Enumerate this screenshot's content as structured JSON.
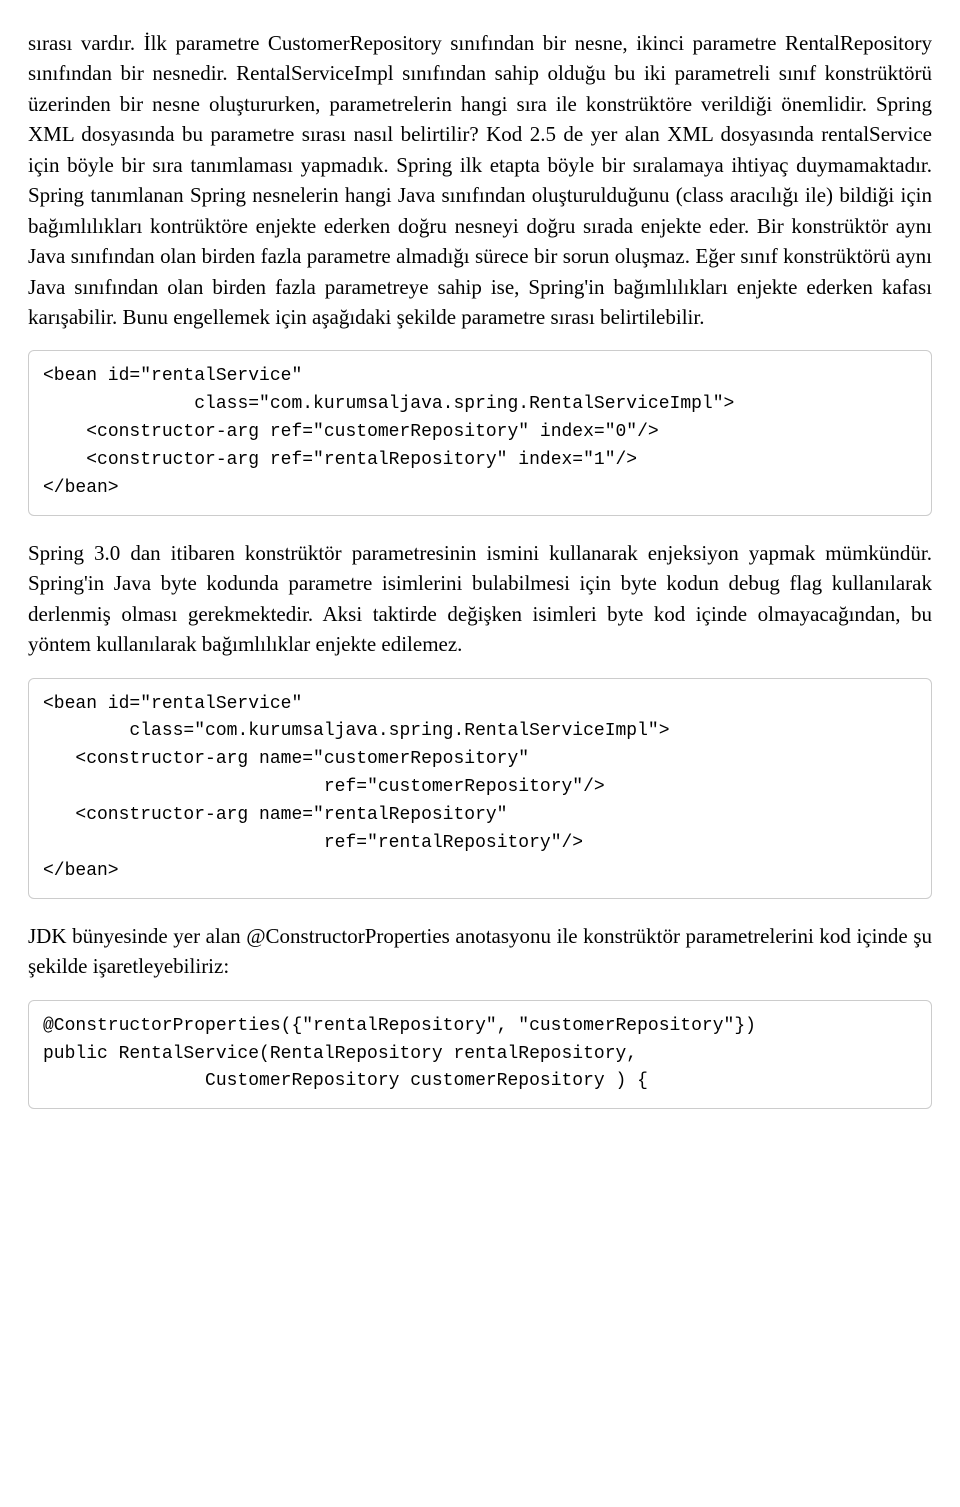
{
  "paragraphs": {
    "p1": "sırası vardır. İlk parametre CustomerRepository sınıfından bir nesne, ikinci parametre RentalRepository sınıfından bir nesnedir. RentalServiceImpl sınıfından sahip olduğu bu iki parametreli sınıf konstrüktörü üzerinden bir nesne oluştururken, parametrelerin hangi sıra ile konstrüktöre verildiği önemlidir. Spring XML dosyasında bu parametre sırası nasıl belirtilir? Kod 2.5 de yer alan XML dosyasında rentalService için böyle bir sıra tanımlaması yapmadık. Spring ilk etapta böyle bir sıralamaya ihtiyaç duymamaktadır. Spring tanımlanan Spring nesnelerin hangi Java sınıfından oluşturulduğunu (class aracılığı ile) bildiği için bağımlılıkları kontrüktöre enjekte ederken doğru nesneyi doğru sırada enjekte eder. Bir konstrüktör aynı Java sınıfından olan birden fazla parametre almadığı sürece bir sorun oluşmaz. Eğer sınıf konstrüktörü aynı Java sınıfından olan birden fazla parametreye sahip ise, Spring'in bağımlılıkları enjekte ederken kafası karışabilir. Bunu engellemek için aşağıdaki şekilde parametre sırası belirtilebilir.",
    "p2": "Spring 3.0 dan itibaren konstrüktör parametresinin ismini kullanarak enjeksiyon yapmak mümkündür. Spring'in Java byte kodunda parametre isimlerini bulabilmesi için byte kodun debug flag kullanılarak derlenmiş olması gerekmektedir. Aksi taktirde değişken isimleri byte kod içinde olmayacağından, bu yöntem kullanılarak bağımlılıklar enjekte edilemez.",
    "p3": "JDK bünyesinde yer alan @ConstructorProperties anotasyonu ile konstrüktör parametrelerini kod içinde şu şekilde işaretleyebiliriz:"
  },
  "code": {
    "c1": "<bean id=\"rentalService\"\n              class=\"com.kurumsaljava.spring.RentalServiceImpl\">\n    <constructor-arg ref=\"customerRepository\" index=\"0\"/>\n    <constructor-arg ref=\"rentalRepository\" index=\"1\"/>\n</bean>",
    "c2": "<bean id=\"rentalService\"\n        class=\"com.kurumsaljava.spring.RentalServiceImpl\">\n   <constructor-arg name=\"customerRepository\"\n                          ref=\"customerRepository\"/>\n   <constructor-arg name=\"rentalRepository\"\n                          ref=\"rentalRepository\"/>\n</bean>",
    "c3": "@ConstructorProperties({\"rentalRepository\", \"customerRepository\"})\npublic RentalService(RentalRepository rentalRepository,\n               CustomerRepository customerRepository ) {"
  }
}
